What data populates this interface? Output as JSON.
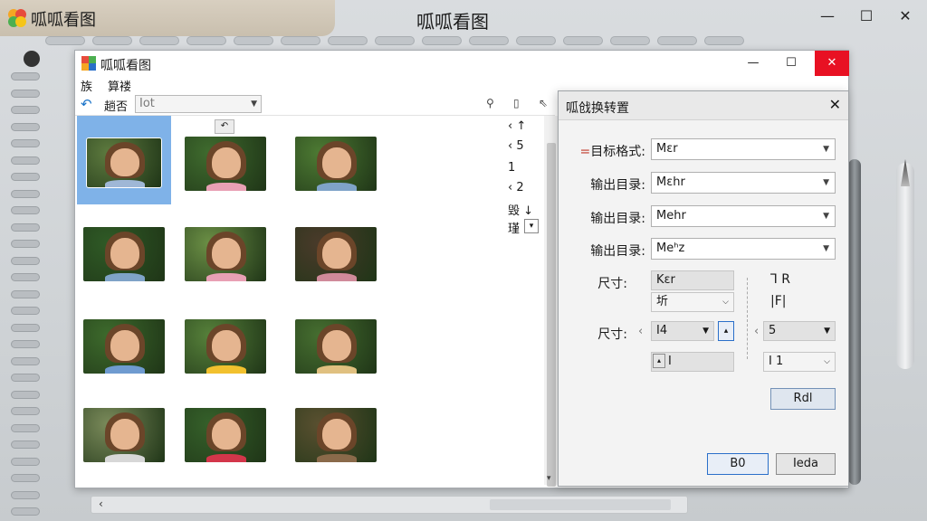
{
  "outer": {
    "app_name": "呱呱看图",
    "center_title": "呱呱看图",
    "controls": {
      "minimize": "—",
      "maximize": "☐",
      "close": "✕"
    }
  },
  "main_window": {
    "title": "呱呱看图",
    "controls": {
      "minimize": "—",
      "maximize": "☐",
      "close": "✕"
    },
    "menu": [
      "族",
      "算褛"
    ],
    "toolbar": {
      "back_icon": "↶",
      "label": "趟否",
      "select_value": "Iot",
      "tools": [
        "⚲",
        "▯",
        "⇖"
      ]
    },
    "small_up_label": "↶",
    "side_column": {
      "items": [
        "‹  ↑",
        "‹  5",
        "1",
        "‹  2",
        "毁 ↓",
        "瑾"
      ],
      "dropdown_arrow": "▾"
    },
    "scroll_down": "▾"
  },
  "dialog": {
    "title": "呱戗换转置",
    "close": "✕",
    "fields": [
      {
        "label": "目标格式:",
        "marker": "=",
        "value": "Mɛr"
      },
      {
        "label": "输出目录:",
        "marker": "",
        "value": "Mɛhr"
      },
      {
        "label": "输出目录:",
        "marker": "",
        "value": "Mehr"
      },
      {
        "label": "输出目录:",
        "marker": "",
        "value": "Meʰz"
      }
    ],
    "size1": {
      "label": "尺寸:",
      "box_top": "Kɛr",
      "box_bottom": "圻",
      "right_top": "Ꞁ R",
      "right_bottom": "|F|"
    },
    "size2": {
      "label": "尺寸:",
      "left_prefix": "‹",
      "left_value": "I4",
      "arrow_btn": "▴",
      "bracket": "‹",
      "right_value": "5",
      "left_bottom": "I",
      "left_bottom_btn": "▴",
      "right_bottom": "I 1"
    },
    "apply_button": "Rdl",
    "ok_button": "B0",
    "cancel_button": "Ieda"
  },
  "bottom_scroll": {
    "left_arrow": "‹"
  },
  "colors": {
    "selection": "#7fb2e8",
    "close_red": "#e81123",
    "accent_blue": "#2a6fc9"
  }
}
